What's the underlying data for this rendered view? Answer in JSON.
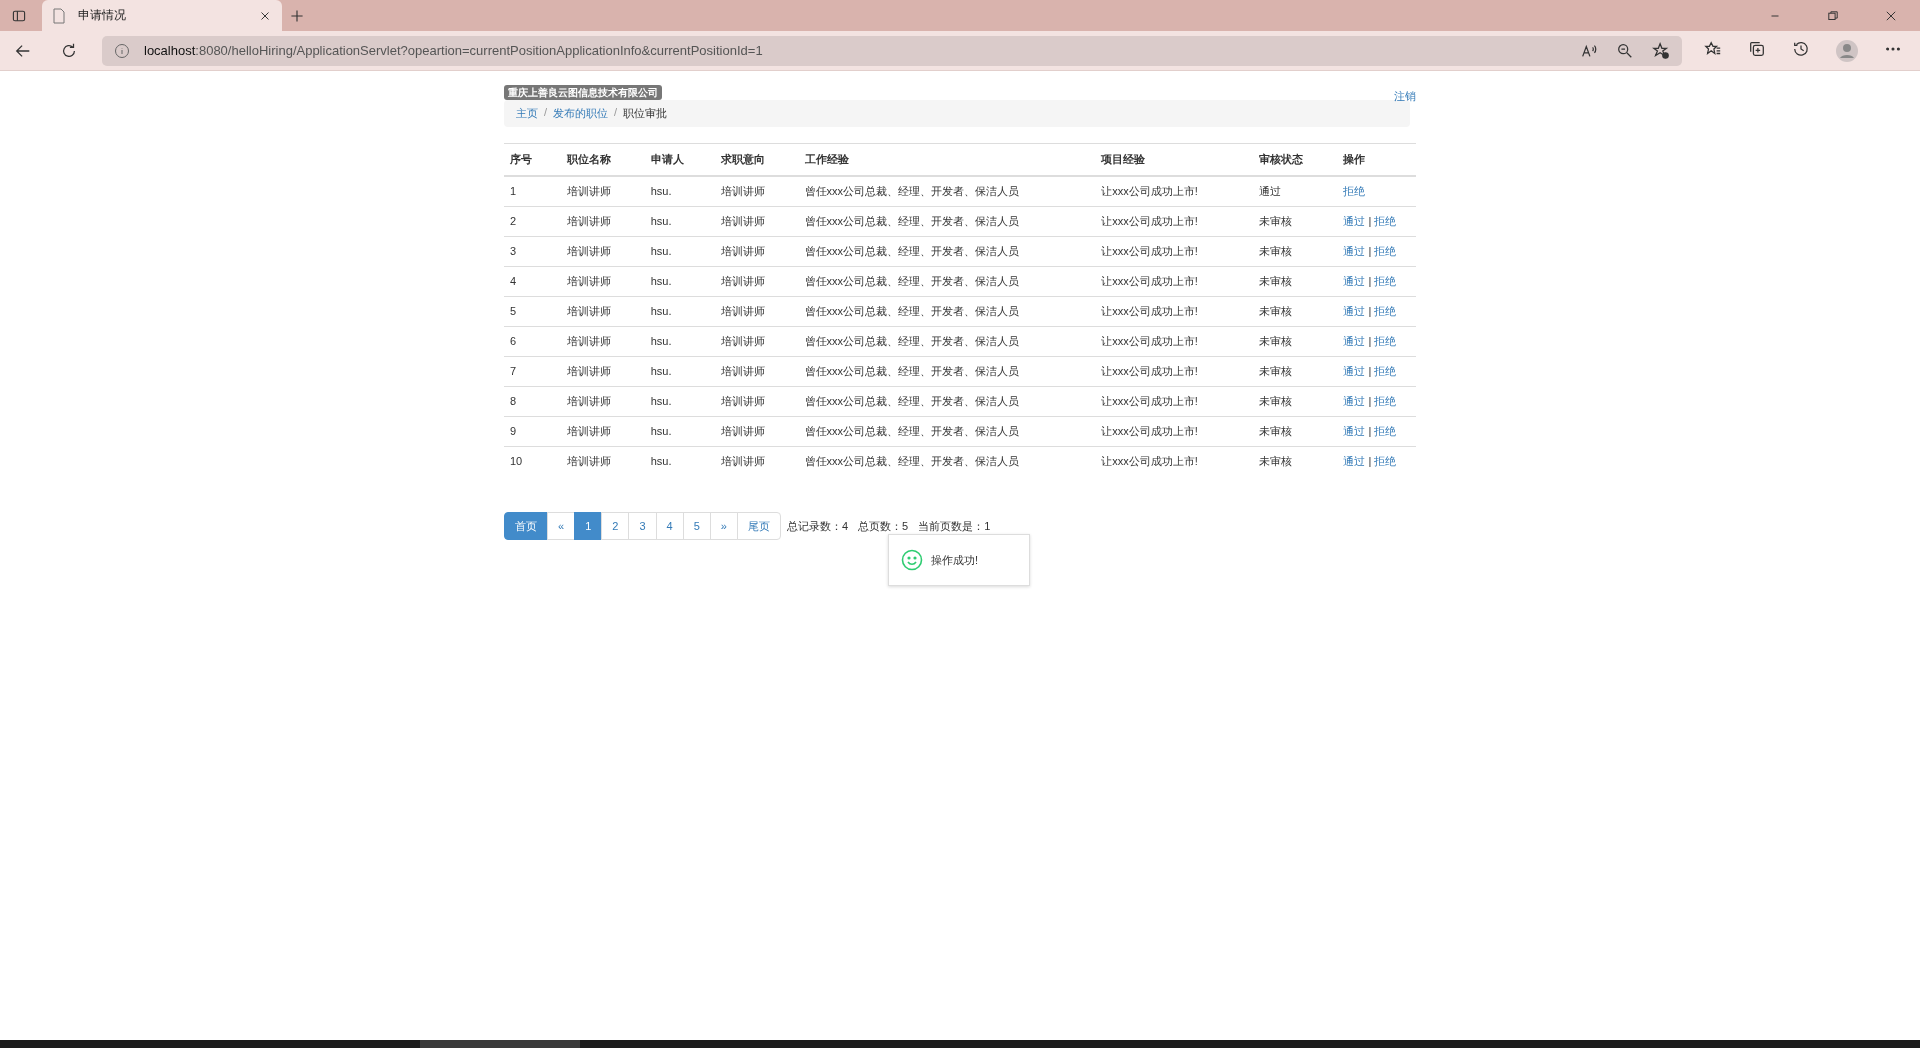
{
  "browser": {
    "tab_title": "申请情况",
    "url_host": "localhost",
    "url_rest": ":8080/helloHiring/ApplicationServlet?opeartion=currentPositionApplicationInfo&currentPositionId=1"
  },
  "header": {
    "company": "重庆上善良云图信息技术有限公司",
    "logout": "注销"
  },
  "breadcrumb": [
    {
      "label": "主页",
      "kind": "link"
    },
    {
      "label": "/",
      "kind": "separator"
    },
    {
      "label": "发布的职位",
      "kind": "link"
    },
    {
      "label": "/",
      "kind": "separator"
    },
    {
      "label": "职位审批",
      "kind": "current"
    }
  ],
  "table": {
    "columns": [
      "序号",
      "职位名称",
      "申请人",
      "求职意向",
      "工作经验",
      "项目经验",
      "审核状态",
      "操作"
    ],
    "rows": [
      {
        "no": "1",
        "position": "培训讲师",
        "applicant": "hsu.",
        "intent": "培训讲师",
        "work": "曾任xxx公司总裁、经理、开发者、保洁人员",
        "project": "让xxx公司成功上市!",
        "status": "通过",
        "actions": [
          {
            "label": "拒绝",
            "kind": "link"
          }
        ]
      },
      {
        "no": "2",
        "position": "培训讲师",
        "applicant": "hsu.",
        "intent": "培训讲师",
        "work": "曾任xxx公司总裁、经理、开发者、保洁人员",
        "project": "让xxx公司成功上市!",
        "status": "未审核",
        "actions": [
          {
            "label": "通过",
            "kind": "link"
          },
          {
            "label": "|",
            "kind": "separator"
          },
          {
            "label": "拒绝",
            "kind": "link"
          }
        ]
      },
      {
        "no": "3",
        "position": "培训讲师",
        "applicant": "hsu.",
        "intent": "培训讲师",
        "work": "曾任xxx公司总裁、经理、开发者、保洁人员",
        "project": "让xxx公司成功上市!",
        "status": "未审核",
        "actions": [
          {
            "label": "通过",
            "kind": "link"
          },
          {
            "label": "|",
            "kind": "separator"
          },
          {
            "label": "拒绝",
            "kind": "link"
          }
        ]
      },
      {
        "no": "4",
        "position": "培训讲师",
        "applicant": "hsu.",
        "intent": "培训讲师",
        "work": "曾任xxx公司总裁、经理、开发者、保洁人员",
        "project": "让xxx公司成功上市!",
        "status": "未审核",
        "actions": [
          {
            "label": "通过",
            "kind": "link"
          },
          {
            "label": "|",
            "kind": "separator"
          },
          {
            "label": "拒绝",
            "kind": "link"
          }
        ]
      },
      {
        "no": "5",
        "position": "培训讲师",
        "applicant": "hsu.",
        "intent": "培训讲师",
        "work": "曾任xxx公司总裁、经理、开发者、保洁人员",
        "project": "让xxx公司成功上市!",
        "status": "未审核",
        "actions": [
          {
            "label": "通过",
            "kind": "link"
          },
          {
            "label": "|",
            "kind": "separator"
          },
          {
            "label": "拒绝",
            "kind": "link"
          }
        ]
      },
      {
        "no": "6",
        "position": "培训讲师",
        "applicant": "hsu.",
        "intent": "培训讲师",
        "work": "曾任xxx公司总裁、经理、开发者、保洁人员",
        "project": "让xxx公司成功上市!",
        "status": "未审核",
        "actions": [
          {
            "label": "通过",
            "kind": "link"
          },
          {
            "label": "|",
            "kind": "separator"
          },
          {
            "label": "拒绝",
            "kind": "link"
          }
        ]
      },
      {
        "no": "7",
        "position": "培训讲师",
        "applicant": "hsu.",
        "intent": "培训讲师",
        "work": "曾任xxx公司总裁、经理、开发者、保洁人员",
        "project": "让xxx公司成功上市!",
        "status": "未审核",
        "actions": [
          {
            "label": "通过",
            "kind": "link"
          },
          {
            "label": "|",
            "kind": "separator"
          },
          {
            "label": "拒绝",
            "kind": "link"
          }
        ]
      },
      {
        "no": "8",
        "position": "培训讲师",
        "applicant": "hsu.",
        "intent": "培训讲师",
        "work": "曾任xxx公司总裁、经理、开发者、保洁人员",
        "project": "让xxx公司成功上市!",
        "status": "未审核",
        "actions": [
          {
            "label": "通过",
            "kind": "link"
          },
          {
            "label": "|",
            "kind": "separator"
          },
          {
            "label": "拒绝",
            "kind": "link"
          }
        ]
      },
      {
        "no": "9",
        "position": "培训讲师",
        "applicant": "hsu.",
        "intent": "培训讲师",
        "work": "曾任xxx公司总裁、经理、开发者、保洁人员",
        "project": "让xxx公司成功上市!",
        "status": "未审核",
        "actions": [
          {
            "label": "通过",
            "kind": "link"
          },
          {
            "label": "|",
            "kind": "separator"
          },
          {
            "label": "拒绝",
            "kind": "link"
          }
        ]
      },
      {
        "no": "10",
        "position": "培训讲师",
        "applicant": "hsu.",
        "intent": "培训讲师",
        "work": "曾任xxx公司总裁、经理、开发者、保洁人员",
        "project": "让xxx公司成功上市!",
        "status": "未审核",
        "actions": [
          {
            "label": "通过",
            "kind": "link"
          },
          {
            "label": "|",
            "kind": "separator"
          },
          {
            "label": "拒绝",
            "kind": "link"
          }
        ]
      }
    ]
  },
  "pagination": {
    "pages": [
      {
        "label": "首页",
        "kind": "first",
        "selected": false
      },
      {
        "label": "«",
        "kind": "prev",
        "selected": false
      },
      {
        "label": "1",
        "kind": "page",
        "selected": true
      },
      {
        "label": "2",
        "kind": "page",
        "selected": false
      },
      {
        "label": "3",
        "kind": "page",
        "selected": false
      },
      {
        "label": "4",
        "kind": "page",
        "selected": false
      },
      {
        "label": "5",
        "kind": "page",
        "selected": false
      },
      {
        "label": "»",
        "kind": "next",
        "selected": false
      },
      {
        "label": "尾页",
        "kind": "last",
        "selected": false
      }
    ],
    "info": [
      "总记录数：4",
      "总页数：5",
      "当前页数是：1"
    ]
  },
  "toast": {
    "message": "操作成功!"
  }
}
